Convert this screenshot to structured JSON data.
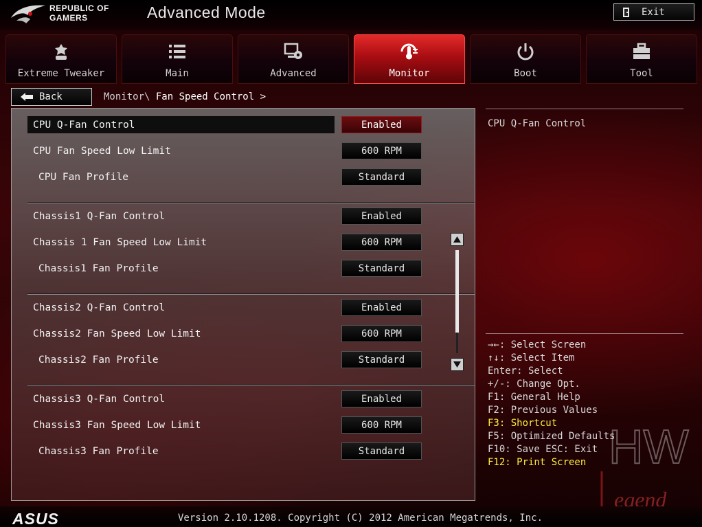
{
  "header": {
    "brand_line1": "REPUBLIC OF",
    "brand_line2": "GAMERS",
    "mode": "Advanced Mode",
    "exit_label": "Exit"
  },
  "tabs": [
    {
      "label": "Extreme Tweaker",
      "icon": "tweaker-icon",
      "active": false
    },
    {
      "label": "Main",
      "icon": "list-icon",
      "active": false
    },
    {
      "label": "Advanced",
      "icon": "advanced-settings-icon",
      "active": false
    },
    {
      "label": "Monitor",
      "icon": "monitor-thermometer-icon",
      "active": true
    },
    {
      "label": "Boot",
      "icon": "power-icon",
      "active": false
    },
    {
      "label": "Tool",
      "icon": "toolbox-icon",
      "active": false
    }
  ],
  "nav": {
    "back_label": "Back",
    "breadcrumb_parent": "Monitor\\",
    "breadcrumb_current": "Fan Speed Control >"
  },
  "settings": [
    {
      "label": "CPU Q-Fan Control",
      "value": "Enabled",
      "selected": true
    },
    {
      "label": "CPU Fan Speed Low Limit",
      "value": "600 RPM"
    },
    {
      "label": "CPU Fan Profile",
      "value": "Standard"
    },
    {
      "label": "Chassis1 Q-Fan Control",
      "value": "Enabled"
    },
    {
      "label": "Chassis 1 Fan Speed Low Limit",
      "value": "600 RPM"
    },
    {
      "label": "Chassis1 Fan Profile",
      "value": "Standard"
    },
    {
      "label": "Chassis2 Q-Fan Control",
      "value": "Enabled"
    },
    {
      "label": "Chassis2 Fan Speed Low Limit",
      "value": "600 RPM"
    },
    {
      "label": "Chassis2 Fan Profile",
      "value": "Standard"
    },
    {
      "label": "Chassis3 Q-Fan Control",
      "value": "Enabled"
    },
    {
      "label": "Chassis3 Fan Speed Low Limit",
      "value": "600 RPM"
    },
    {
      "label": "Chassis3 Fan Profile",
      "value": "Standard"
    }
  ],
  "help": {
    "title": "CPU Q-Fan Control"
  },
  "hotkeys": [
    {
      "text": "→←: Select Screen",
      "highlight": false
    },
    {
      "text": "↑↓: Select Item",
      "highlight": false
    },
    {
      "text": "Enter: Select",
      "highlight": false
    },
    {
      "text": "+/-: Change Opt.",
      "highlight": false
    },
    {
      "text": "F1: General Help",
      "highlight": false
    },
    {
      "text": "F2: Previous Values",
      "highlight": false
    },
    {
      "text": "F3: Shortcut",
      "highlight": true
    },
    {
      "text": "F5: Optimized Defaults",
      "highlight": false
    },
    {
      "text": "F10: Save  ESC: Exit",
      "highlight": false
    },
    {
      "text": "F12: Print Screen",
      "highlight": true
    }
  ],
  "footer": {
    "brand": "ASUS",
    "version": "Version 2.10.1208. Copyright (C) 2012 American Megatrends, Inc."
  },
  "watermark": {
    "text_top": "HW",
    "text_bottom": "egend"
  },
  "colors": {
    "accent": "#c8141a",
    "highlight_text": "#ffef3a"
  }
}
